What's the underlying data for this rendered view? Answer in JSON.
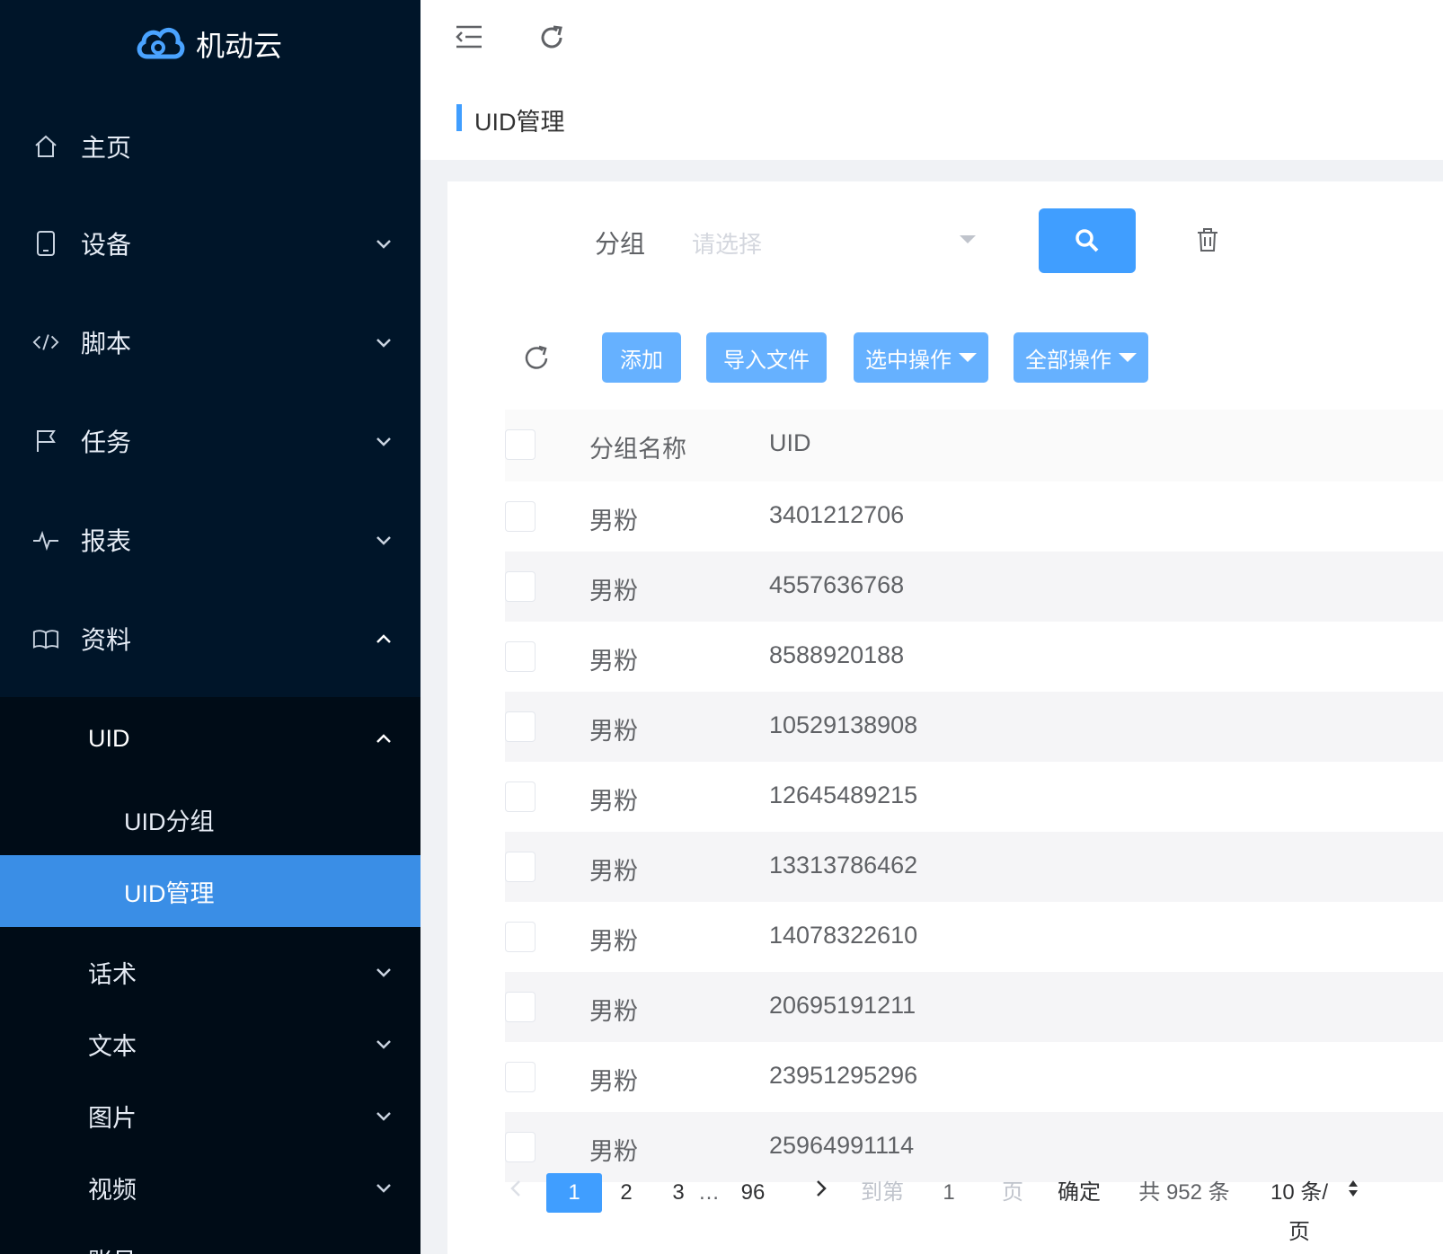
{
  "app": {
    "name": "机动云"
  },
  "sidebar": {
    "items": [
      {
        "label": "主页",
        "icon": "home-icon"
      },
      {
        "label": "设备",
        "icon": "tablet-icon"
      },
      {
        "label": "脚本",
        "icon": "code-icon"
      },
      {
        "label": "任务",
        "icon": "flag-icon"
      },
      {
        "label": "报表",
        "icon": "pulse-icon"
      },
      {
        "label": "资料",
        "icon": "book-icon"
      }
    ],
    "uid_group": "UID",
    "uid_children": [
      "UID分组",
      "UID管理"
    ],
    "more_items": [
      "话术",
      "文本",
      "图片",
      "视频",
      "账号"
    ]
  },
  "breadcrumb": {
    "title": "UID管理"
  },
  "filter": {
    "label": "分组",
    "placeholder": "请选择"
  },
  "toolbar": {
    "add": "添加",
    "import": "导入文件",
    "selected_ops": "选中操作",
    "all_ops": "全部操作"
  },
  "table": {
    "columns": [
      "分组名称",
      "UID"
    ],
    "rows": [
      [
        "男粉",
        "3401212706"
      ],
      [
        "男粉",
        "4557636768"
      ],
      [
        "男粉",
        "8588920188"
      ],
      [
        "男粉",
        "10529138908"
      ],
      [
        "男粉",
        "12645489215"
      ],
      [
        "男粉",
        "13313786462"
      ],
      [
        "男粉",
        "14078322610"
      ],
      [
        "男粉",
        "20695191211"
      ],
      [
        "男粉",
        "23951295296"
      ],
      [
        "男粉",
        "25964991114"
      ]
    ]
  },
  "pagination": {
    "pages": [
      "1",
      "2",
      "3",
      "…",
      "96"
    ],
    "current": "1",
    "goto_label": "到第",
    "goto_value": "1",
    "page_suffix": "页",
    "confirm": "确定",
    "total": "共 952 条",
    "page_size": "10 条/页"
  },
  "colors": {
    "sidebar_bg": "#001529",
    "accent": "#409eff",
    "button": "#66b1ff"
  }
}
